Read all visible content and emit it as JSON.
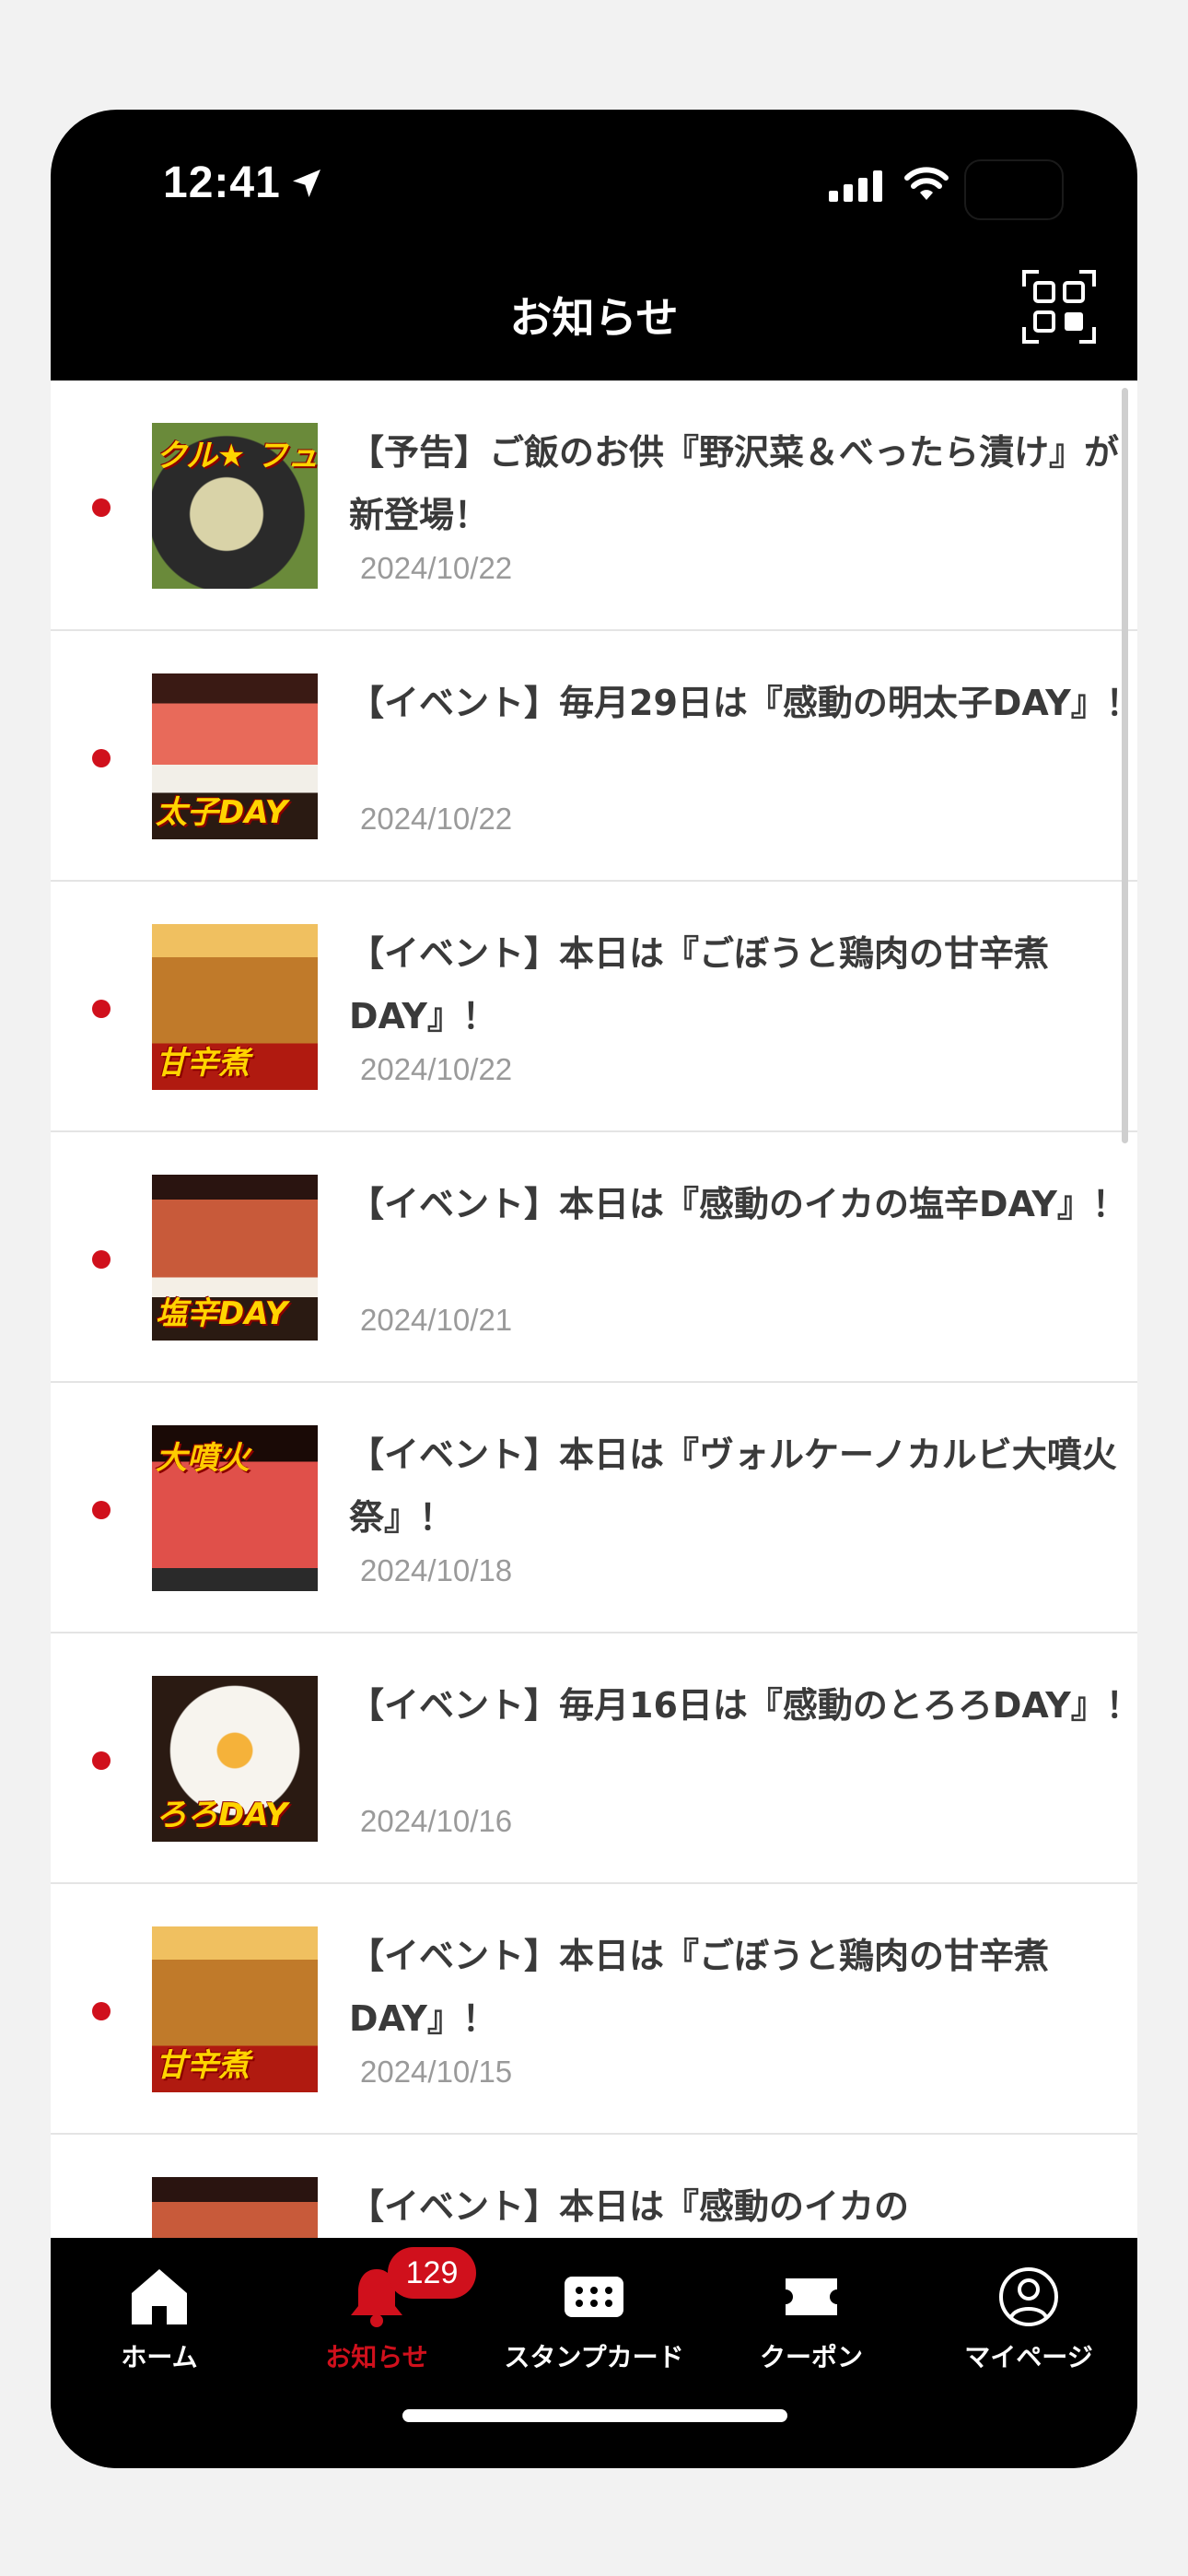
{
  "status_bar": {
    "time": "12:41"
  },
  "header": {
    "title": "お知らせ"
  },
  "colors": {
    "accent": "#d0101c",
    "background": "#000000"
  },
  "notifications": [
    {
      "title": "【予告】ご飯のお供『野沢菜＆べったら漬け』が新登場！",
      "date": "2024/10/22",
      "unread": true,
      "thumb_text": "クル★ フュージ"
    },
    {
      "title": "【イベント】毎月29日は『感動の明太子DAY』！",
      "date": "2024/10/22",
      "unread": true,
      "thumb_text": "太子DAY"
    },
    {
      "title": "【イベント】本日は『ごぼうと鶏肉の甘辛煮DAY』！",
      "date": "2024/10/22",
      "unread": true,
      "thumb_text": "甘辛煮"
    },
    {
      "title": "【イベント】本日は『感動のイカの塩辛DAY』！",
      "date": "2024/10/21",
      "unread": true,
      "thumb_text": "塩辛DAY"
    },
    {
      "title": "【イベント】本日は『ヴォルケーノカルビ大噴火祭』！",
      "date": "2024/10/18",
      "unread": true,
      "thumb_text": "大噴火"
    },
    {
      "title": "【イベント】毎月16日は『感動のとろろDAY』！",
      "date": "2024/10/16",
      "unread": true,
      "thumb_text": "ろろDAY"
    },
    {
      "title": "【イベント】本日は『ごぼうと鶏肉の甘辛煮DAY』！",
      "date": "2024/10/15",
      "unread": true,
      "thumb_text": "甘辛煮"
    },
    {
      "title": "【イベント】本日は『感動のイカの",
      "date": "",
      "unread": false,
      "thumb_text": ""
    }
  ],
  "tab_bar": {
    "home": "ホーム",
    "notifications": "お知らせ",
    "notifications_badge": "129",
    "stamp_card": "スタンプカード",
    "coupon": "クーポン",
    "mypage": "マイページ"
  }
}
